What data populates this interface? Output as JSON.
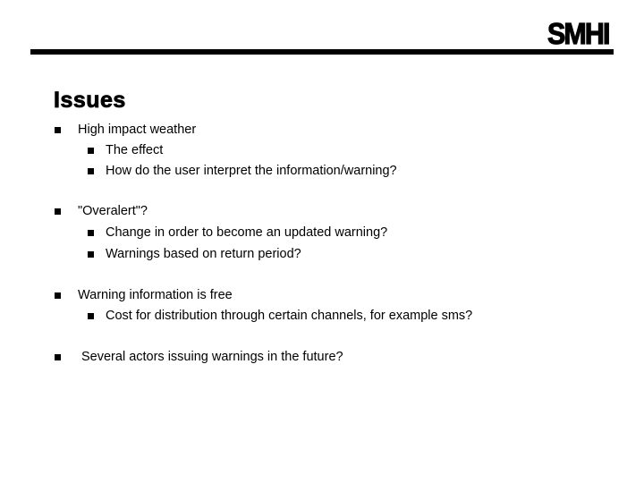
{
  "logo": {
    "text": "SMHI"
  },
  "slide": {
    "title": "Issues",
    "bullets": [
      {
        "text": "High impact weather"
      },
      {
        "text": "The effect"
      },
      {
        "text": "How do the user interpret the information/warning?"
      },
      {
        "text": "\"Overalert\"?"
      },
      {
        "text": "Change in order to become an updated warning?"
      },
      {
        "text": "Warnings based on return period?"
      },
      {
        "text": "Warning information is free"
      },
      {
        "text": "Cost for distribution through certain channels, for example sms?"
      },
      {
        "text": "Several actors issuing warnings in the future?"
      }
    ]
  }
}
